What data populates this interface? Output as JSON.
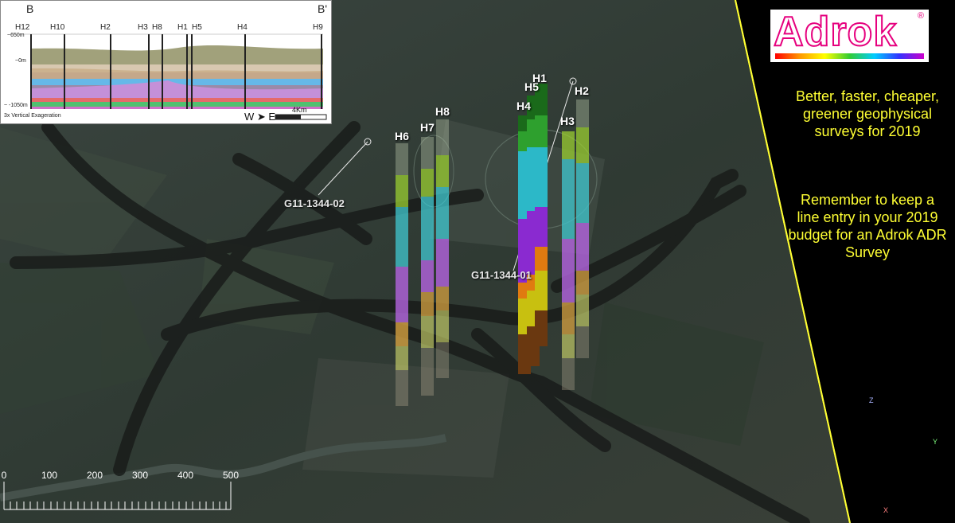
{
  "inset": {
    "section_start": "B",
    "section_end": "B'",
    "holes": [
      "H12",
      "H10",
      "H2",
      "H3",
      "H8",
      "H1",
      "H5",
      "H4",
      "H9"
    ],
    "depth_top": "~650m",
    "depth_mid": "~0m",
    "depth_bottom": "~ -1050m",
    "vertical_exaggeration": "3x Vertical Exageration",
    "direction": "W ➤ E",
    "scale_label": "4Km"
  },
  "columns": [
    "H1",
    "H5",
    "H4",
    "H2",
    "H3",
    "H8",
    "H7",
    "H6"
  ],
  "wells": [
    "G11-1344-02",
    "G11-1344-01"
  ],
  "brand": {
    "logo_text": "Adrok",
    "registered": "®"
  },
  "taglines": {
    "first": "Better, faster, cheaper, greener geophysical surveys for 2019",
    "second": "Remember to keep a line entry in your 2019 budget for an Adrok ADR Survey"
  },
  "scale_bar": {
    "ticks": [
      "0",
      "100",
      "200",
      "300",
      "400",
      "500"
    ]
  },
  "axes": {
    "z": "Z",
    "x": "X",
    "y": "Y"
  },
  "colors": {
    "accent_pink": "#e6007e",
    "tagline_yellow": "#ffff33",
    "panel_bg": "#000000"
  }
}
